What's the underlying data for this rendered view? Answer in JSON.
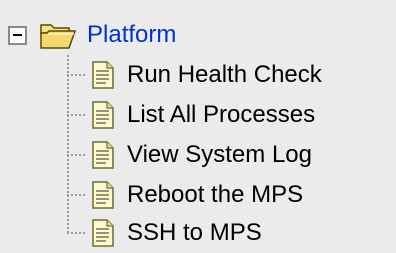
{
  "tree": {
    "root": {
      "label": "Platform",
      "expanded": true,
      "icon": "open-folder-icon"
    },
    "children": [
      {
        "label": "Run Health Check",
        "icon": "document-icon"
      },
      {
        "label": "List All Processes",
        "icon": "document-icon"
      },
      {
        "label": "View System Log",
        "icon": "document-icon"
      },
      {
        "label": "Reboot the MPS",
        "icon": "document-icon"
      },
      {
        "label": "SSH to MPS",
        "icon": "document-icon"
      }
    ]
  },
  "colors": {
    "background": "#ebebeb",
    "root_label": "#0033cc",
    "child_label": "#000000",
    "folder": "#f5d76e"
  }
}
